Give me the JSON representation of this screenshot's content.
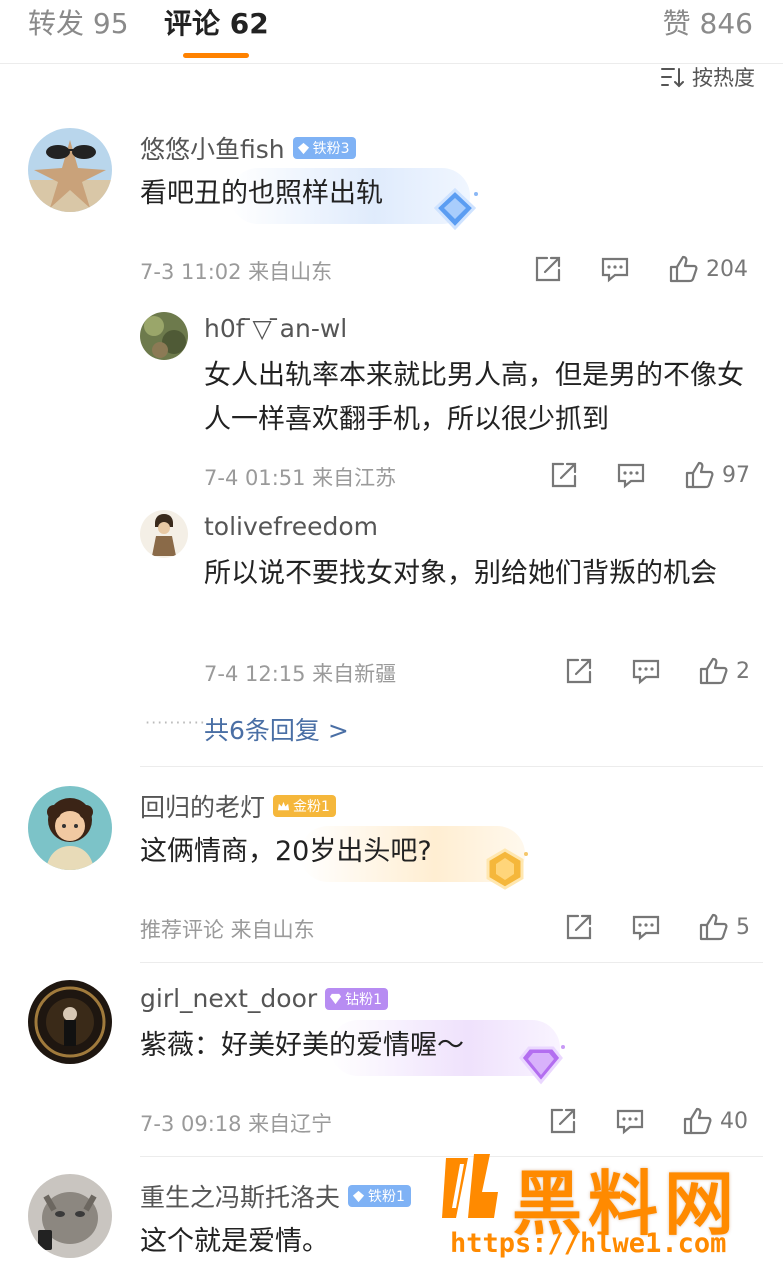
{
  "tabs": {
    "repost": "转发 95",
    "comments": "评论 62",
    "likes": "赞 846"
  },
  "sort_label": "按热度",
  "comments": [
    {
      "username": "悠悠小鱼fish",
      "badge": "铁粉3",
      "text": "看吧丑的也照样出轨",
      "meta": "7-3 11:02 来自山东",
      "likes": "204",
      "replies": [
        {
          "username": "h0f ̄▽ ̄an-wl",
          "text": "女人出轨率本来就比男人高，但是男的不像女人一样喜欢翻手机，所以很少抓到",
          "meta": "7-4 01:51 来自江苏",
          "likes": "97"
        },
        {
          "username": "tolivefreedom",
          "text": "所以说不要找女对象，别给她们背叛的机会",
          "meta": "7-4 12:15 来自新疆",
          "likes": "2"
        }
      ],
      "more_replies": "共6条回复 >"
    },
    {
      "username": "回归的老灯",
      "badge": "金粉1",
      "text": "这俩情商，20岁出头吧?",
      "meta": "推荐评论 来自山东",
      "likes": "5"
    },
    {
      "username": "girl_next_door",
      "badge": "钻粉1",
      "text": "紫薇：好美好美的爱情喔～",
      "meta": "7-3 09:18 来自辽宁",
      "likes": "40"
    },
    {
      "username": "重生之冯斯托洛夫",
      "badge": "铁粉1",
      "text": "这个就是爱情。"
    }
  ],
  "watermark": {
    "title": "黑料网",
    "url": "https://hlwe1.com"
  },
  "colors": {
    "accent": "#ff8200",
    "link": "#4a6fa5",
    "badge_iron": "#7fb2f5",
    "badge_gold": "#f5b73b",
    "badge_diamond": "#b78cf2"
  }
}
